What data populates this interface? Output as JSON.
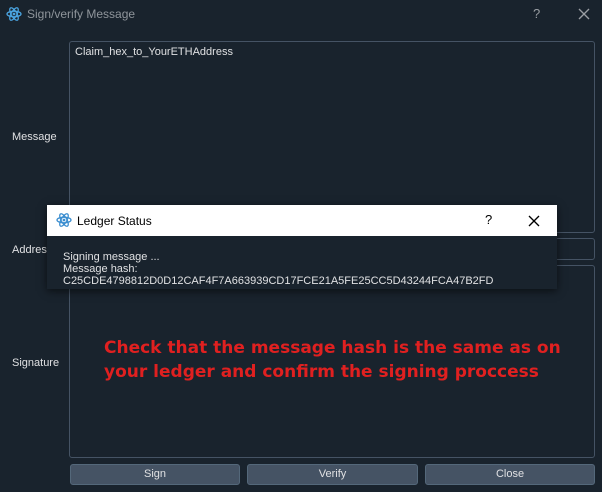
{
  "window": {
    "title": "Sign/verify Message",
    "help_glyph": "?",
    "icon": "electrum-atom-icon"
  },
  "form": {
    "message_label": "Message",
    "message_value": "Claim_hex_to_YourETHAddress",
    "address_label": "Address",
    "signature_label": "Signature"
  },
  "buttons": {
    "sign": "Sign",
    "verify": "Verify",
    "close": "Close"
  },
  "dialog": {
    "title": "Ledger Status",
    "help_glyph": "?",
    "line1": "Signing message ...",
    "line2": "Message hash: C25CDE4798812D0D12CAF4F7A663939CD17FCE21A5FE25CC5D43244FCA47B2FD"
  },
  "annotation": {
    "text": "Check that the message hash is the same as on your ledger and confirm the signing proccess",
    "color": "#e02020"
  },
  "colors": {
    "background": "#19232d",
    "border": "#455364",
    "button": "#455364"
  }
}
